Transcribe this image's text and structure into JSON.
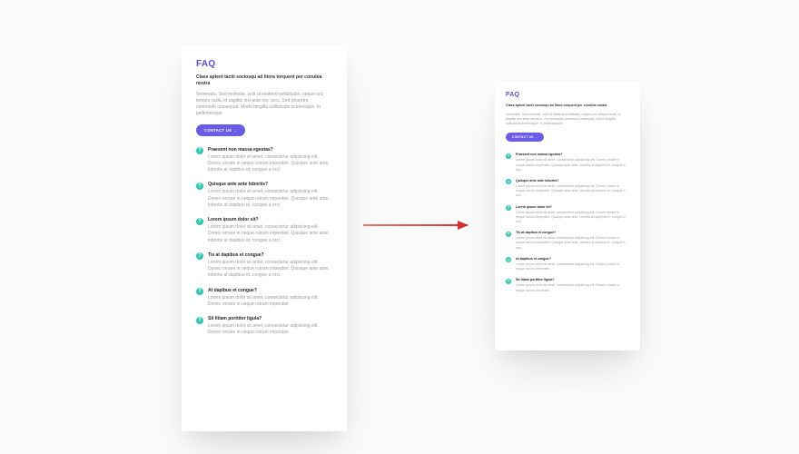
{
  "faq": {
    "title": "FAQ",
    "lead": "Class aptent taciti sociosqu ad litora torquent per conubia nostra",
    "intro": "Venenatis. Sed molestie, velit ut eleifend sollicitudin, neque orci tempor nulla, id sagittis nisi ante nec arcu. Sed pharetra commodo consequat. Morbi fringilla sollicitudin scelerisque. In pellentesque.",
    "cta": "CONTACT US →",
    "items": [
      {
        "q": "Praesent non massa egestas?",
        "a": "Lorem ipsum dolor sit amet, consectetur adipiscing elit. Donec ornare in neque rutrum imperdiet. Quisque ante ante, lobortis at dapibus et, congue a orci."
      },
      {
        "q": "Quisque ante ante lobortis?",
        "a": "Lorem ipsum dolor sit amet, consectetur adipiscing elit. Donec ornare in neque rutrum imperdiet. Quisque ante ante, lobortis at dapibus et, congue a orci."
      },
      {
        "q": "Lorem ipsum dolor sit?",
        "a": "Lorem ipsum dolor sit amet, consectetur adipiscing elit. Donec ornare in neque rutrum imperdiet. Quisque ante ante, lobortis at dapibus et, congue a orci."
      },
      {
        "q": "Tis at dapibus et congue?",
        "a": "Lorem ipsum dolor sit amet, consectetur adipiscing elit. Donec ornare in neque rutrum imperdiet. Quisque ante ante, lobortis at dapibus et, congue a orci."
      },
      {
        "q": "At dapibus et congue?",
        "a": "Lorem ipsum dolor sit amet, consectetur adipiscing elit. Donec ornare in neque rutrum imperdiet."
      },
      {
        "q": "Sit litiam porttitor ligula?",
        "a": "Lorem ipsum dolor sit amet, consectetur adipiscing elit. Donec ornare in neque rutrum imperdiet."
      }
    ]
  }
}
